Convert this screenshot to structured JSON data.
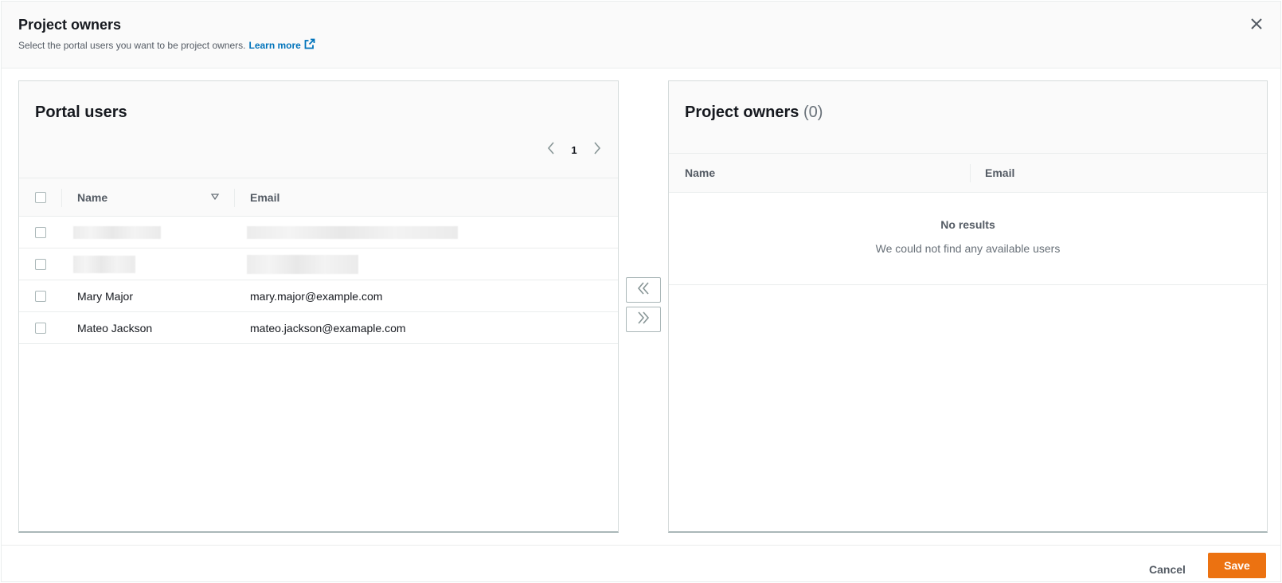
{
  "modal": {
    "title": "Project owners",
    "description": "Select the portal users you want to be project owners.",
    "learn_more": "Learn more"
  },
  "left_panel": {
    "title": "Portal users",
    "pagination": {
      "current_page": "1"
    },
    "columns": {
      "name": "Name",
      "email": "Email"
    },
    "rows": [
      {
        "name": "",
        "email": "",
        "redacted": true
      },
      {
        "name": "",
        "email": "",
        "redacted": true
      },
      {
        "name": "Mary Major",
        "email": "mary.major@example.com"
      },
      {
        "name": "Mateo Jackson",
        "email": "mateo.jackson@examaple.com"
      }
    ]
  },
  "right_panel": {
    "title": "Project owners",
    "count": "(0)",
    "columns": {
      "name": "Name",
      "email": "Email"
    },
    "empty_title": "No results",
    "empty_desc": "We could not find any available users"
  },
  "footer": {
    "cancel_label": "Cancel",
    "save_label": "Save"
  },
  "colors": {
    "accent": "#ec7211",
    "link": "#0073bb"
  },
  "icons": {
    "close": "close-icon",
    "external_link": "external-link-icon",
    "prev_page": "chevron-left-icon",
    "next_page": "chevron-right-icon",
    "sort": "sort-down-icon",
    "move_left": "double-chevron-left-icon",
    "move_right": "double-chevron-right-icon"
  }
}
